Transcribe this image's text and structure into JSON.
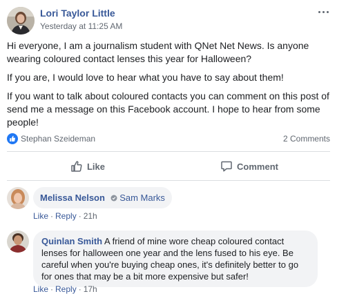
{
  "post": {
    "author": "Lori Taylor Little",
    "timestamp": "Yesterday at 11:25 AM",
    "paragraphs": [
      "Hi everyone, I am a journalism student with QNet Net News. Is anyone wearing coloured contact lenses this year for Halloween?",
      "If you are, I would love to hear what you have to say about them!",
      "If you want to talk about coloured contacts you can comment on this post of send me a message on this Facebook account. I hope to hear from some people!"
    ],
    "liker": "Stephan Szeideman",
    "comments_count": "2 Comments"
  },
  "actions": {
    "like_label": "Like",
    "comment_label": "Comment"
  },
  "comments": [
    {
      "author": "Melissa Nelson",
      "tagged": "Sam Marks",
      "text": "",
      "like_label": "Like",
      "reply_label": "Reply",
      "age": "21h"
    },
    {
      "author": "Quinlan Smith",
      "text": "A friend of mine wore cheap coloured contact lenses for halloween one year and the lens fused to his eye. Be careful when you're buying cheap ones, it's definitely better to go for ones that may be a bit more expensive but safer!",
      "like_label": "Like",
      "reply_label": "Reply",
      "age": "17h"
    }
  ],
  "colors": {
    "link_blue": "#385898",
    "like_badge": "#2078f4",
    "bubble_bg": "#f2f3f5",
    "meta_gray": "#606770"
  }
}
